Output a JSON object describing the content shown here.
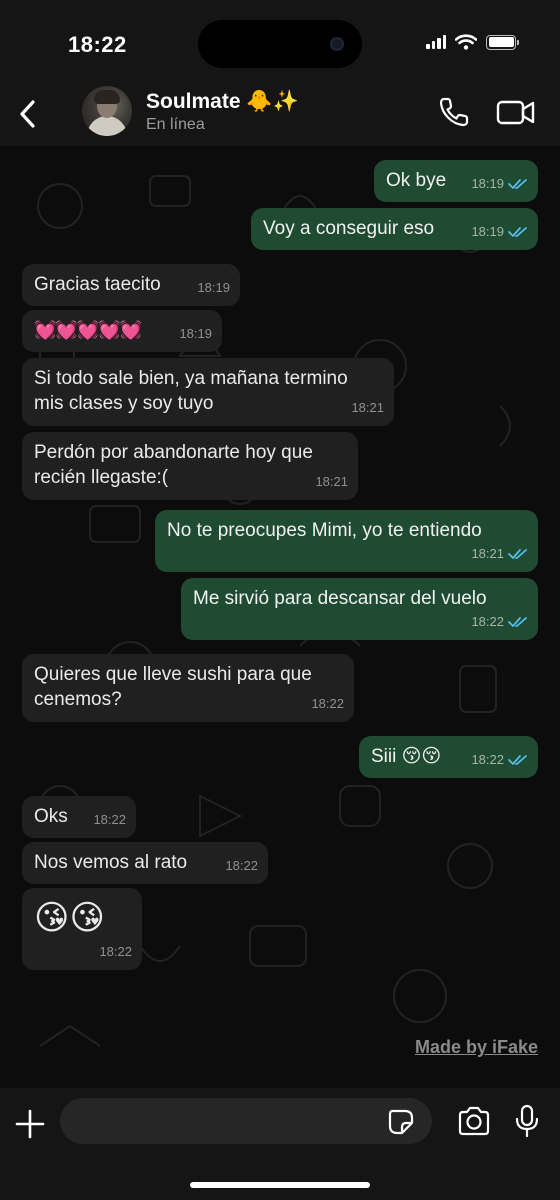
{
  "status_bar": {
    "time": "18:22"
  },
  "header": {
    "contact_name": "Soulmate 🐥✨",
    "contact_status": "En línea"
  },
  "messages": [
    {
      "direction": "out",
      "text": "Ok bye",
      "time": "18:19",
      "read": true
    },
    {
      "direction": "out",
      "text": "Voy a conseguir eso",
      "time": "18:19",
      "read": true
    },
    {
      "direction": "in",
      "text": "Gracias taecito",
      "time": "18:19"
    },
    {
      "direction": "in",
      "text": "💓💓💓💓💓",
      "time": "18:19"
    },
    {
      "direction": "in",
      "text": "Si todo sale bien, ya mañana termino mis clases y soy tuyo",
      "time": "18:21"
    },
    {
      "direction": "in",
      "text": "Perdón por abandonarte hoy que recién llegaste:(",
      "time": "18:21"
    },
    {
      "direction": "out",
      "text": "No te preocupes Mimi, yo te entiendo",
      "time": "18:21",
      "read": true
    },
    {
      "direction": "out",
      "text": "Me sirvió para descansar del vuelo",
      "time": "18:22",
      "read": true
    },
    {
      "direction": "in",
      "text": "Quieres que lleve sushi para que cenemos?",
      "time": "18:22"
    },
    {
      "direction": "out",
      "text": "Siii 😚😚",
      "time": "18:22",
      "read": true
    },
    {
      "direction": "in",
      "text": "Oks",
      "time": "18:22"
    },
    {
      "direction": "in",
      "text": "Nos vemos al rato",
      "time": "18:22"
    },
    {
      "direction": "in",
      "text": "😘😘",
      "time": "18:22"
    }
  ],
  "watermark": "Made by iFake",
  "input": {
    "placeholder": ""
  },
  "colors": {
    "outgoing_bubble": "#1f4b33",
    "incoming_bubble": "#202020",
    "read_ticks": "#53bdeb"
  },
  "icons": [
    "back-chevron-icon",
    "phone-icon",
    "video-camera-icon",
    "plus-icon",
    "sticker-icon",
    "camera-icon",
    "microphone-icon"
  ]
}
